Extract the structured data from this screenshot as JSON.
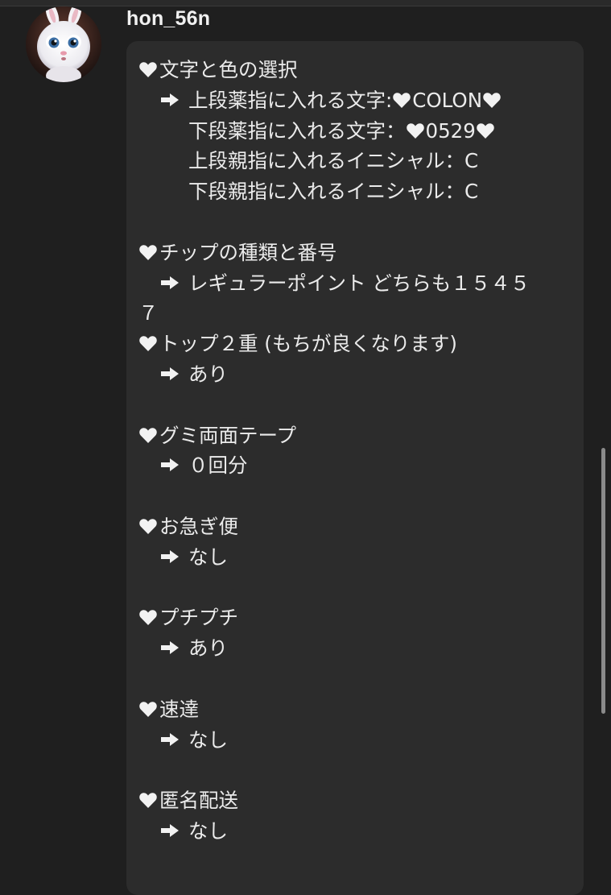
{
  "post": {
    "username": "hon_56n",
    "avatar_icon": "avatar-bunny-icon"
  },
  "message": {
    "choice_heading": "文字と色の選択",
    "ring_upper_label": "上段薬指に入れる文字:",
    "ring_upper_value": "COLON",
    "ring_lower_label": "下段薬指に入れる文字：",
    "ring_lower_value": "0529",
    "thumb_upper": "上段親指に入れるイニシャル：C",
    "thumb_lower": "下段親指に入れるイニシャル：C",
    "chip_heading": "チップの種類と番号",
    "chip_value_line1": "レギュラーポイント どちらも１５４５",
    "chip_value_line2": "７",
    "top_heading": "トップ２重 (もちが良くなります)",
    "top_value": "あり",
    "gumi_heading": "グミ両面テープ",
    "gumi_value": "０回分",
    "express_heading": "お急ぎ便",
    "express_value": "なし",
    "wrap_heading": "プチプチ",
    "wrap_value": "あり",
    "speed_heading": "速達",
    "speed_value": "なし",
    "anon_heading": "匿名配送",
    "anon_value": "なし"
  },
  "colors": {
    "background": "#1f1f1f",
    "bubble": "#2c2c2c",
    "text": "#ebebeb",
    "heart": "#f2f2f2",
    "scrollbar_thumb": "#8a8a8a"
  },
  "scrollbar": {
    "position_fraction": 0.52
  }
}
